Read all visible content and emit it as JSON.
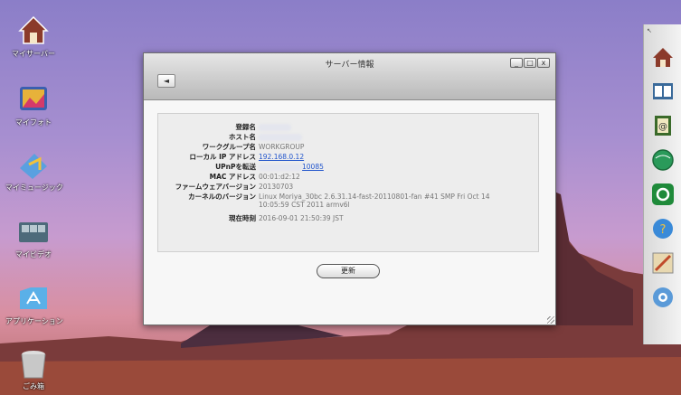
{
  "desktop": {
    "icons": [
      {
        "label": "マイサーバー",
        "icon": "home-icon"
      },
      {
        "label": "マイフォト",
        "icon": "photo-icon"
      },
      {
        "label": "マイミュージック",
        "icon": "music-icon"
      },
      {
        "label": "マイビデオ",
        "icon": "video-icon"
      },
      {
        "label": "アプリケーション",
        "icon": "apps-icon"
      },
      {
        "label": "ごみ箱",
        "icon": "trash-icon"
      }
    ]
  },
  "dock": {
    "items": [
      "home-icon",
      "contacts-icon",
      "email-icon",
      "globe-icon",
      "sync-icon",
      "info-icon",
      "settings-panel-icon",
      "gear-icon"
    ]
  },
  "window": {
    "title": "サーバー情報",
    "controls": {
      "minimize": "_",
      "maximize": "□",
      "close": "x"
    },
    "back_label": "◄",
    "rows": [
      {
        "key": "登録名",
        "value": ""
      },
      {
        "key": "ホスト名",
        "value": ""
      },
      {
        "key": "ワークグループ名",
        "value": "WORKGROUP"
      },
      {
        "key": "ローカル IP アドレス",
        "value": "192.168.0.12"
      },
      {
        "key": "UPnPを転送",
        "value": "10085"
      },
      {
        "key": "MAC アドレス",
        "value": "00:01:d2:12"
      },
      {
        "key": "ファームウェアバージョン",
        "value": "20130703"
      },
      {
        "key": "カーネルのバージョン",
        "value": "Linux Moriya_30bc 2.6.31.14-fast-20110801-fan #41 SMP Fri Oct 14",
        "value2": "10:05:59 CST 2011 armv6l"
      },
      {
        "key": "現在時刻",
        "value": "2016-09-01 21:50:39 JST"
      }
    ],
    "refresh_label": "更新"
  }
}
